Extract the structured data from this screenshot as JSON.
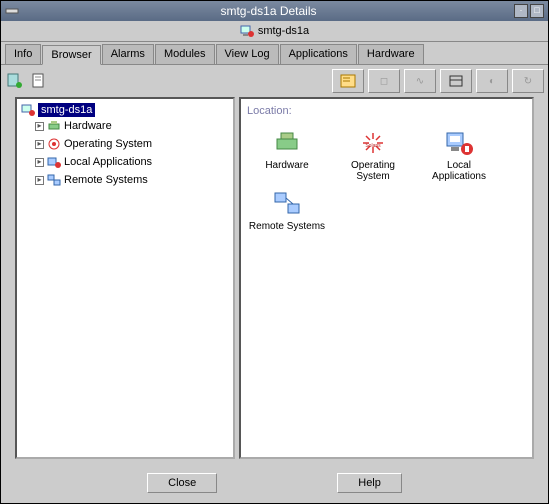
{
  "titlebar": {
    "text": "smtg-ds1a Details"
  },
  "subtitle": "smtg-ds1a",
  "tabs": [
    {
      "label": "Info"
    },
    {
      "label": "Browser"
    },
    {
      "label": "Alarms"
    },
    {
      "label": "Modules"
    },
    {
      "label": "View Log"
    },
    {
      "label": "Applications"
    },
    {
      "label": "Hardware"
    }
  ],
  "tree": {
    "root": "smtg-ds1a",
    "items": [
      {
        "label": "Hardware"
      },
      {
        "label": "Operating System"
      },
      {
        "label": "Local Applications"
      },
      {
        "label": "Remote Systems"
      }
    ]
  },
  "detail": {
    "location_label": "Location:",
    "icons": [
      {
        "label": "Hardware"
      },
      {
        "label": "Operating System"
      },
      {
        "label": "Local Applications"
      },
      {
        "label": "Remote Systems"
      }
    ]
  },
  "footer": {
    "close": "Close",
    "help": "Help"
  }
}
